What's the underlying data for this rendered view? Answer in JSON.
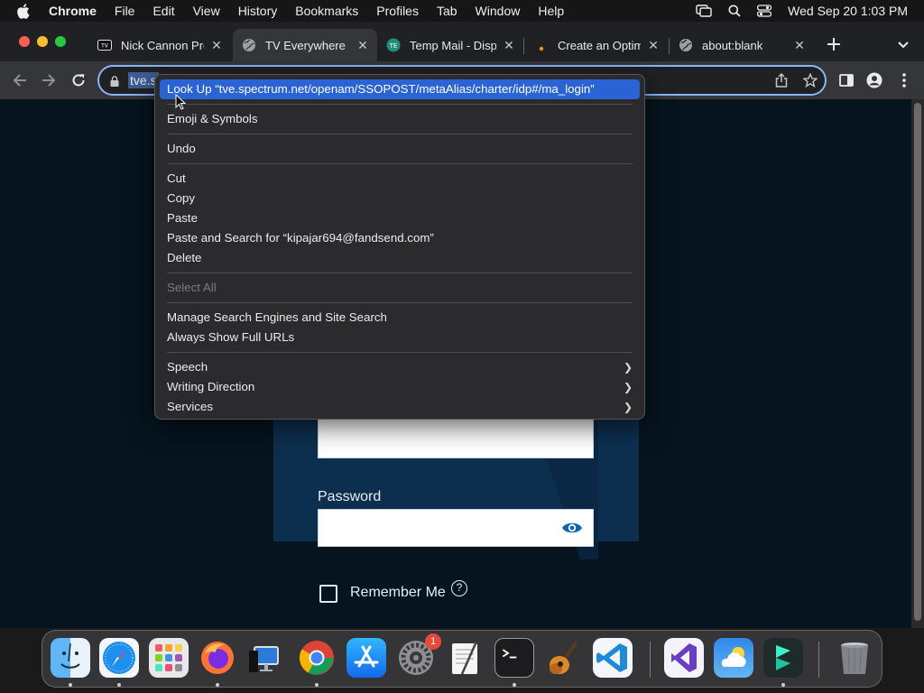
{
  "menubar": {
    "app_name": "Chrome",
    "items": [
      "File",
      "Edit",
      "View",
      "History",
      "Bookmarks",
      "Profiles",
      "Tab",
      "Window",
      "Help"
    ],
    "datetime": "Wed Sep 20  1:03 PM"
  },
  "tabs": [
    {
      "title": "Nick Cannon Pres",
      "favicon": "tv-icon",
      "active": false
    },
    {
      "title": "TV Everywhere",
      "favicon": "globe-icon",
      "active": true
    },
    {
      "title": "Temp Mail - Disp",
      "favicon": "tempmail-icon",
      "active": false
    },
    {
      "title": "Create an Optimu",
      "favicon": "dot-icon",
      "active": false
    },
    {
      "title": "about:blank",
      "favicon": "globe-icon",
      "active": false
    }
  ],
  "toolbar": {
    "url_visible": "tve.s"
  },
  "context_menu": {
    "groups": [
      [
        {
          "label": "Look Up “tve.spectrum.net/openam/SSOPOST/metaAlias/charter/idp#/ma_login”",
          "state": "highlighted"
        }
      ],
      [
        {
          "label": "Emoji & Symbols",
          "state": "normal"
        }
      ],
      [
        {
          "label": "Undo",
          "state": "normal"
        }
      ],
      [
        {
          "label": "Cut",
          "state": "normal"
        },
        {
          "label": "Copy",
          "state": "normal"
        },
        {
          "label": "Paste",
          "state": "normal"
        },
        {
          "label": "Paste and Search for “kipajar694@fandsend.com”",
          "state": "normal"
        },
        {
          "label": "Delete",
          "state": "normal"
        }
      ],
      [
        {
          "label": "Select All",
          "state": "disabled"
        }
      ],
      [
        {
          "label": "Manage Search Engines and Site Search",
          "state": "normal"
        },
        {
          "label": "Always Show Full URLs",
          "state": "normal"
        }
      ],
      [
        {
          "label": "Speech",
          "state": "submenu"
        },
        {
          "label": "Writing Direction",
          "state": "submenu"
        },
        {
          "label": "Services",
          "state": "submenu"
        }
      ]
    ]
  },
  "page": {
    "password_label": "Password",
    "remember_me_label": "Remember Me",
    "help_glyph": "?"
  },
  "dock": {
    "apps": [
      "Finder",
      "Safari",
      "Launchpad",
      "Firefox",
      "Screen Sharing",
      "Chrome",
      "App Store",
      "System Settings",
      "TextEdit",
      "Terminal",
      "GarageBand",
      "VS Code",
      "Visual Studio",
      "Weather",
      "Filmora",
      "Trash"
    ],
    "settings_badge": "1"
  },
  "colors": {
    "accent": "#2a63d4",
    "page_bg": "#05141f",
    "panel_bg": "#0d2f4f"
  }
}
